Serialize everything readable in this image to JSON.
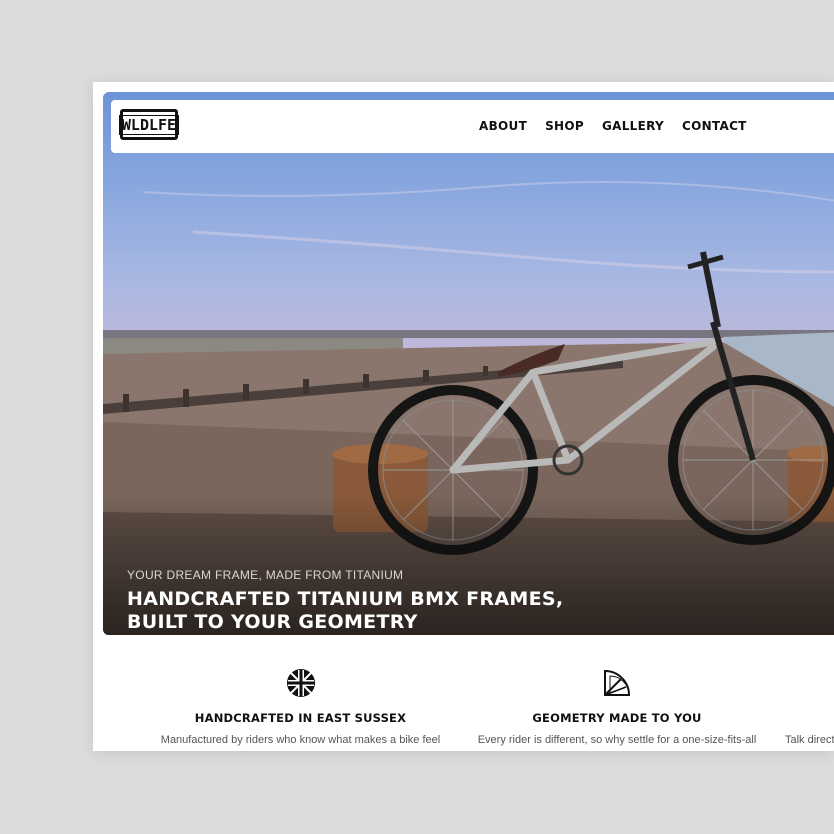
{
  "brand": {
    "logo_text": "WLDLFE"
  },
  "nav": {
    "items": [
      {
        "label": "ABOUT"
      },
      {
        "label": "SHOP"
      },
      {
        "label": "GALLERY"
      },
      {
        "label": "CONTACT"
      }
    ]
  },
  "hero": {
    "subtitle": "YOUR DREAM FRAME, MADE FROM TITANIUM",
    "title_line1": "HANDCRAFTED TITANIUM BMX FRAMES,",
    "title_line2": "BUILT TO YOUR GEOMETRY",
    "image_icon": "bmx-bike-on-beach-photo"
  },
  "features": [
    {
      "icon": "union-jack-icon",
      "title": "HANDCRAFTED IN EAST SUSSEX",
      "description": "Manufactured by riders who know what makes a bike feel"
    },
    {
      "icon": "protractor-icon",
      "title": "GEOMETRY MADE TO YOU",
      "description": "Every rider is different, so why settle for a one-size-fits-all"
    },
    {
      "icon": "",
      "title": "",
      "description": "Talk direct"
    }
  ],
  "colors": {
    "background": "#dcdcdc",
    "text": "#111111",
    "muted": "#555555"
  }
}
